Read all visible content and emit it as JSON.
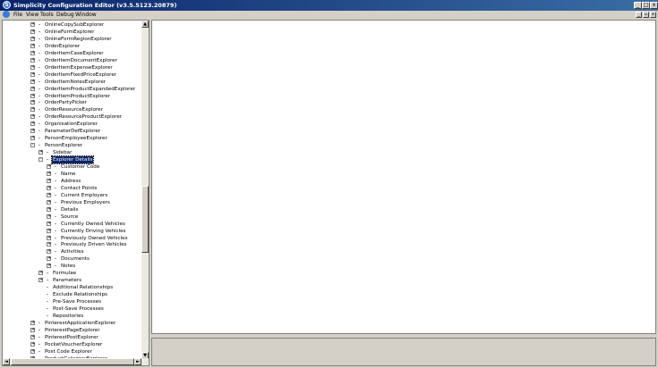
{
  "window": {
    "title": "Simplicity Configuration Editor (v3.5.5123.20879)",
    "icon": "app-logo-icon",
    "icon_glyph": "S",
    "controls": [
      "_",
      "□",
      "x"
    ]
  },
  "menubar": {
    "items": [
      "File",
      "View",
      "Tools",
      "Debug",
      "Window"
    ],
    "mdi_controls": [
      "_",
      "▫",
      "x"
    ]
  },
  "tree": {
    "selected": "Explorer Details",
    "nodes": [
      {
        "label": "OnlineCopySubExplorer",
        "level": 0,
        "toggle": "+"
      },
      {
        "label": "OnlineFormExplorer",
        "level": 0,
        "toggle": "+"
      },
      {
        "label": "OnlineFormRegionExplorer",
        "level": 0,
        "toggle": "+"
      },
      {
        "label": "OrderExplorer",
        "level": 0,
        "toggle": "+"
      },
      {
        "label": "OrderItemCaseExplorer",
        "level": 0,
        "toggle": "+"
      },
      {
        "label": "OrderItemDocumentExplorer",
        "level": 0,
        "toggle": "+"
      },
      {
        "label": "OrderItemExpenseExplorer",
        "level": 0,
        "toggle": "+"
      },
      {
        "label": "OrderItemFixedPriceExplorer",
        "level": 0,
        "toggle": "+"
      },
      {
        "label": "OrderItemNotesExplorer",
        "level": 0,
        "toggle": "+"
      },
      {
        "label": "OrderItemProductExpandedExplorer",
        "level": 0,
        "toggle": "+"
      },
      {
        "label": "OrderItemProductExplorer",
        "level": 0,
        "toggle": "+"
      },
      {
        "label": "OrderPartyPicker",
        "level": 0,
        "toggle": "+"
      },
      {
        "label": "OrderResourceExplorer",
        "level": 0,
        "toggle": "+"
      },
      {
        "label": "OrderResourceProductExplorer",
        "level": 0,
        "toggle": "+"
      },
      {
        "label": "OrganisationExplorer",
        "level": 0,
        "toggle": "+"
      },
      {
        "label": "ParameterDefExplorer",
        "level": 0,
        "toggle": "+"
      },
      {
        "label": "PersonEmployeeExplorer",
        "level": 0,
        "toggle": "+"
      },
      {
        "label": "PersonExplorer",
        "level": 0,
        "toggle": "-"
      },
      {
        "label": "Sidebar",
        "level": 1,
        "toggle": "+"
      },
      {
        "label": "Explorer Details",
        "level": 1,
        "toggle": "-"
      },
      {
        "label": "Customer Code",
        "level": 2,
        "toggle": "+"
      },
      {
        "label": "Name",
        "level": 2,
        "toggle": "+"
      },
      {
        "label": "Address",
        "level": 2,
        "toggle": "+"
      },
      {
        "label": "Contact Points",
        "level": 2,
        "toggle": "+"
      },
      {
        "label": "Current Employers",
        "level": 2,
        "toggle": "+"
      },
      {
        "label": "Previous Employers",
        "level": 2,
        "toggle": "+"
      },
      {
        "label": "Details",
        "level": 2,
        "toggle": "+"
      },
      {
        "label": "Source",
        "level": 2,
        "toggle": "+"
      },
      {
        "label": "Currently Owned Vehicles",
        "level": 2,
        "toggle": "+"
      },
      {
        "label": "Currently Driving Vehicles",
        "level": 2,
        "toggle": "+"
      },
      {
        "label": "Previously Owned Vehicles",
        "level": 2,
        "toggle": "+"
      },
      {
        "label": "Previously Driven Vehicles",
        "level": 2,
        "toggle": "+"
      },
      {
        "label": "Activities",
        "level": 2,
        "toggle": "+"
      },
      {
        "label": "Documents",
        "level": 2,
        "toggle": "+"
      },
      {
        "label": "Notes",
        "level": 2,
        "toggle": "+"
      },
      {
        "label": "Formulae",
        "level": 1,
        "toggle": "+"
      },
      {
        "label": "Parameters",
        "level": 1,
        "toggle": "+"
      },
      {
        "label": "Additional Relationships",
        "level": 1,
        "toggle": ""
      },
      {
        "label": "Exclude Relationships",
        "level": 1,
        "toggle": ""
      },
      {
        "label": "Pre-Save Processes",
        "level": 1,
        "toggle": ""
      },
      {
        "label": "Post-Save Processes",
        "level": 1,
        "toggle": ""
      },
      {
        "label": "Repositories",
        "level": 1,
        "toggle": ""
      },
      {
        "label": "PinterestApplicationExplorer",
        "level": 0,
        "toggle": "+"
      },
      {
        "label": "PinterestPageExplorer",
        "level": 0,
        "toggle": "+"
      },
      {
        "label": "PinterestPostExplorer",
        "level": 0,
        "toggle": "+"
      },
      {
        "label": "PocketVoucherExplorer",
        "level": 0,
        "toggle": "+"
      },
      {
        "label": "Post Code Explorer",
        "level": 0,
        "toggle": "+"
      },
      {
        "label": "ProductCategoryExplorer",
        "level": 0,
        "toggle": "+"
      }
    ]
  },
  "scrollbars": {
    "vertical": {
      "up_arrow": "▲",
      "down_arrow": "▼"
    },
    "horizontal": {
      "left_arrow": "◄",
      "right_arrow": "►"
    }
  }
}
